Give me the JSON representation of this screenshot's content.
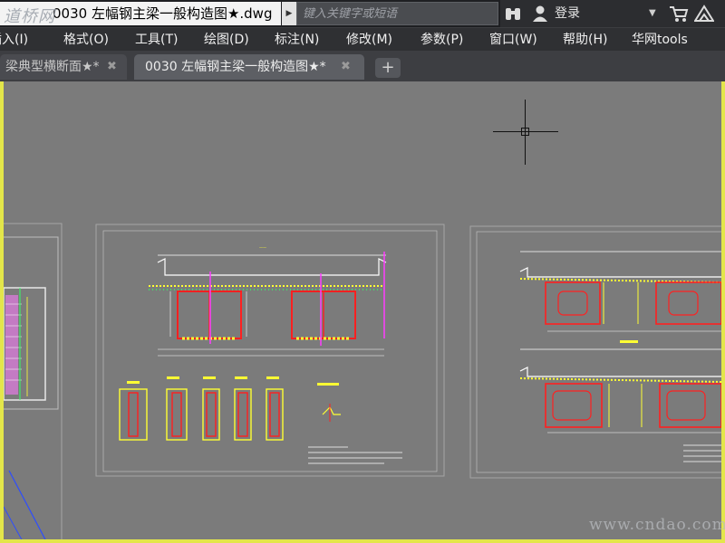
{
  "app": {
    "document_title": "0030 左幅钢主梁一般构造图★.dwg",
    "watermark_top": "道桥网",
    "watermark_bottom": "www.cndao.com"
  },
  "search": {
    "placeholder": "键入关键字或短语"
  },
  "account": {
    "login_label": "登录"
  },
  "menu": {
    "items": [
      {
        "label": "插入(I)"
      },
      {
        "label": "格式(O)"
      },
      {
        "label": "工具(T)"
      },
      {
        "label": "绘图(D)"
      },
      {
        "label": "标注(N)"
      },
      {
        "label": "修改(M)"
      },
      {
        "label": "参数(P)"
      },
      {
        "label": "窗口(W)"
      },
      {
        "label": "帮助(H)"
      },
      {
        "label": "华网tools"
      }
    ]
  },
  "tabs": [
    {
      "label": "梁典型横断面★*",
      "active": false
    },
    {
      "label": "0030 左幅钢主梁一般构造图★*",
      "active": true
    }
  ],
  "icons": {
    "binoculars": "binoculars-icon",
    "user": "user-icon",
    "cart": "cart-icon",
    "triangle": "autodesk-icon",
    "close": "close-icon",
    "add": "add-tab-icon"
  },
  "colors": {
    "canvas": "#7b7b7b",
    "accent_border": "#e3e64a",
    "drawing_red": "#ff2020",
    "drawing_yellow": "#ffff33",
    "drawing_magenta": "#ff3cff",
    "drawing_green": "#33ff66"
  }
}
